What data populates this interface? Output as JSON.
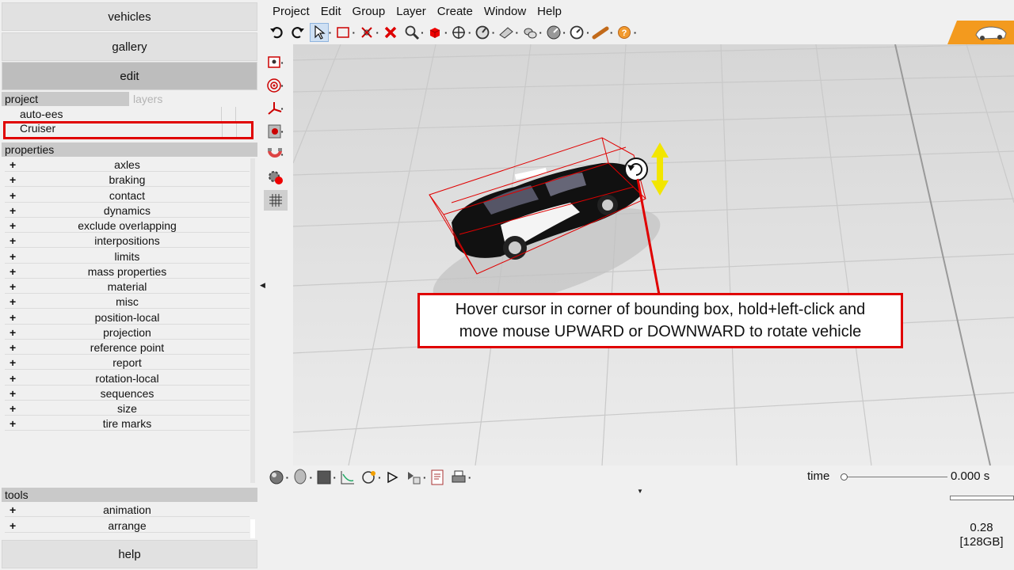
{
  "nav": {
    "vehicles": "vehicles",
    "gallery": "gallery",
    "edit": "edit",
    "help": "help"
  },
  "project_panel": {
    "tab_project": "project",
    "tab_layers": "layers",
    "items": [
      "auto-ees",
      "Cruiser"
    ],
    "selected": "Cruiser"
  },
  "properties": {
    "header": "properties",
    "rows": [
      "axles",
      "braking",
      "contact",
      "dynamics",
      "exclude overlapping",
      "interpositions",
      "limits",
      "mass properties",
      "material",
      "misc",
      "position-local",
      "projection",
      "reference point",
      "report",
      "rotation-local",
      "sequences",
      "size",
      "tire marks"
    ]
  },
  "tools": {
    "header": "tools",
    "rows": [
      "animation",
      "arrange"
    ]
  },
  "menu": [
    "Project",
    "Edit",
    "Group",
    "Layer",
    "Create",
    "Window",
    "Help"
  ],
  "toolbar_icons": [
    "undo-icon",
    "redo-icon",
    "pointer-icon",
    "rectangle-select-icon",
    "path-icon",
    "delete-icon",
    "zoom-icon",
    "cube-icon",
    "move-icon",
    "gauge-icon",
    "ramp-icon",
    "tire-icon",
    "dial-icon",
    "speed-icon",
    "baton-icon",
    "help-icon"
  ],
  "side_tools": [
    "camera-icon",
    "target-icon",
    "axes-icon",
    "film-icon",
    "magnet-icon",
    "gear-record-icon",
    "grid-icon"
  ],
  "bottom_icons": [
    "sphere-icon",
    "head-icon",
    "color-square-icon",
    "graph-icon",
    "path-curve-icon",
    "play-icon",
    "step-icon",
    "report-icon",
    "print-icon"
  ],
  "callout": {
    "line1": "Hover cursor in corner of bounding box, hold+left-click and",
    "line2": "move mouse UPWARD or DOWNWARD to rotate vehicle"
  },
  "time": {
    "label": "time",
    "value": "0.000 s",
    "position": 0.0
  },
  "stats": {
    "fps": "0.28",
    "memory": "[128GB]"
  },
  "colors": {
    "highlight_red": "#e00000",
    "arrow_yellow": "#f2e600",
    "badge_orange": "#f39a1e"
  }
}
